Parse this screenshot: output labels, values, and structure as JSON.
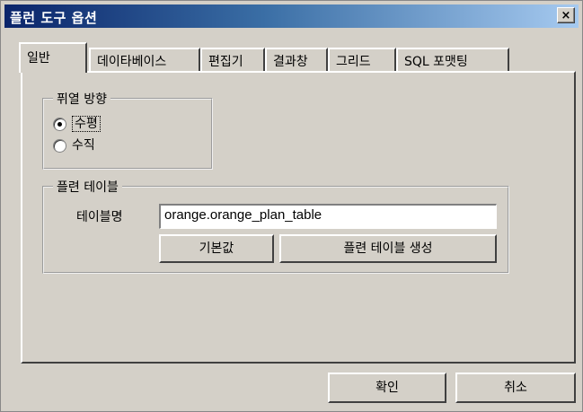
{
  "window": {
    "title": "플런 도구 옵션",
    "close_glyph": "×"
  },
  "tabs": [
    {
      "label": "일반",
      "active": true
    },
    {
      "label": "데이타베이스"
    },
    {
      "label": "편집기"
    },
    {
      "label": "결과창"
    },
    {
      "label": "그리드"
    },
    {
      "label": "SQL 포맷팅"
    }
  ],
  "orientation_group": {
    "legend": "퓌열 방향",
    "options": [
      {
        "label": "수평",
        "checked": true
      },
      {
        "label": "수직",
        "checked": false
      }
    ]
  },
  "plan_table_group": {
    "legend": "플련 테이블",
    "table_name_label": "테이블명",
    "table_name_value": "orange.orange_plan_table",
    "default_button": "기본값",
    "create_button": "플련 테이블 생성"
  },
  "footer": {
    "ok_button": "확인",
    "cancel_button": "취소"
  }
}
